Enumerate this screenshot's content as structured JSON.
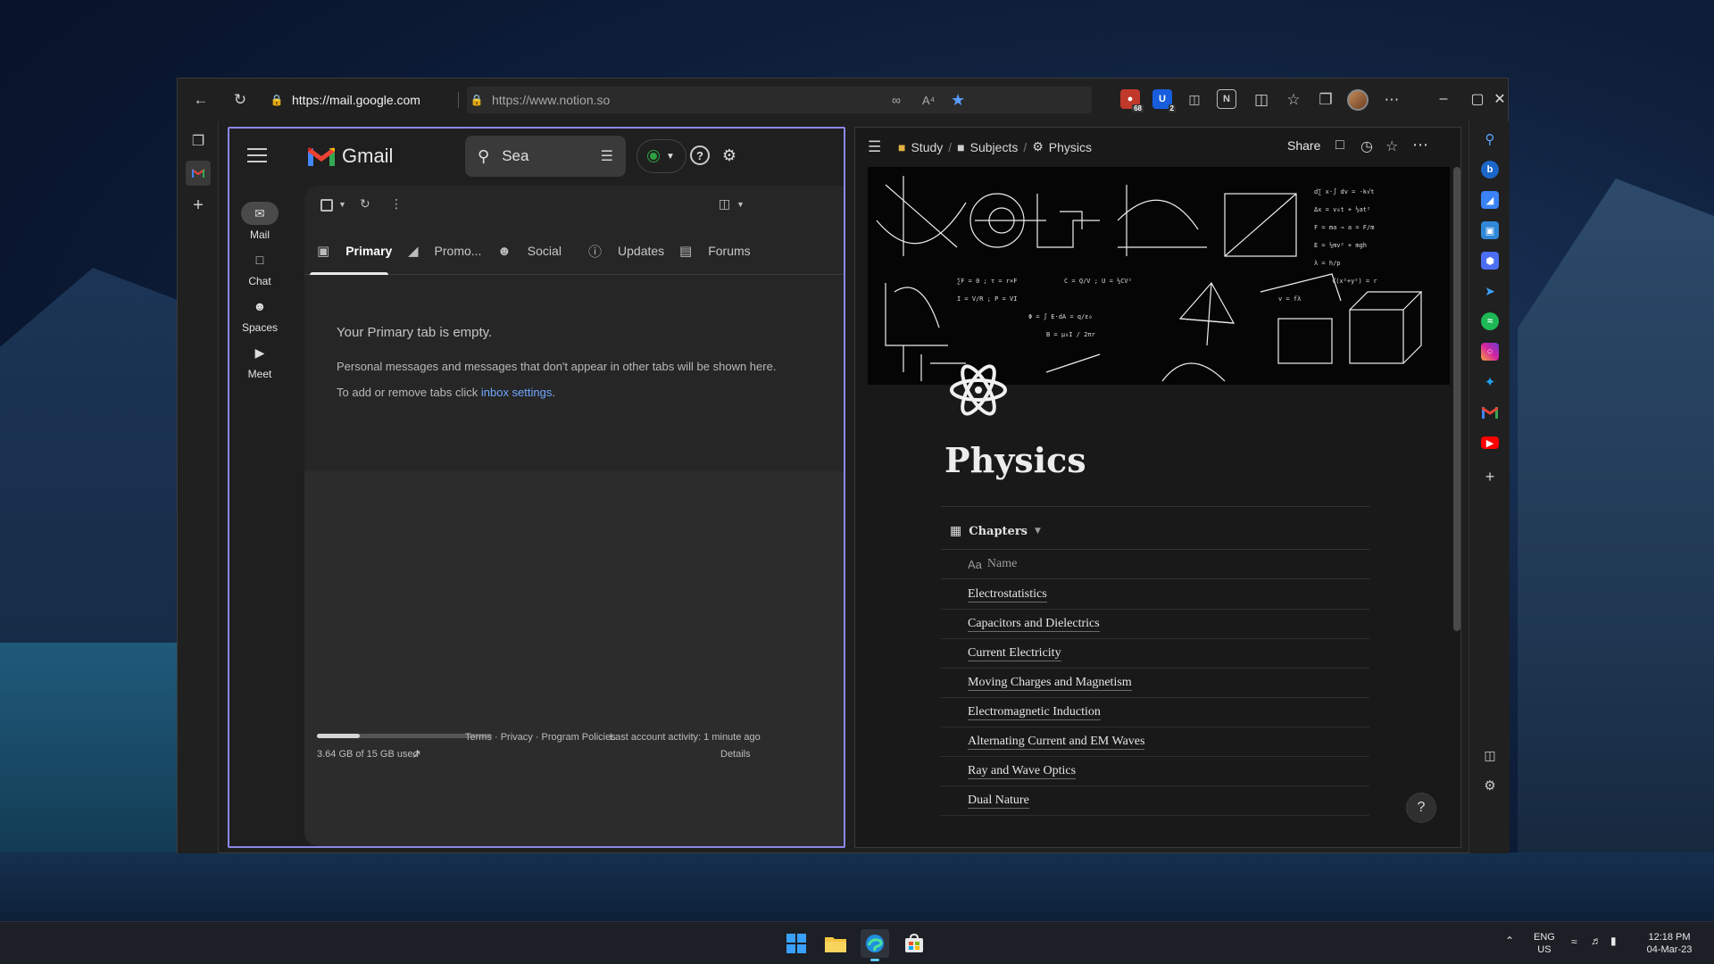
{
  "browser": {
    "url_primary": "https://mail.google.com",
    "url_secondary": "https://www.notion.so",
    "extensions": [
      {
        "name": "extension-1",
        "badge": "68",
        "color": "#c0392b"
      },
      {
        "name": "bitwarden",
        "badge": "2",
        "color": "#175ddc"
      },
      {
        "name": "clipboard",
        "badge": "",
        "color": "#555555"
      },
      {
        "name": "notion-clipper",
        "badge": "",
        "color": "#444444"
      }
    ],
    "menu_label": "⋯"
  },
  "gmail": {
    "app_name": "Gmail",
    "search_text": "Sea",
    "rail": [
      {
        "label": "Mail",
        "icon": "mail-icon"
      },
      {
        "label": "Chat",
        "icon": "chat-icon"
      },
      {
        "label": "Spaces",
        "icon": "spaces-icon"
      },
      {
        "label": "Meet",
        "icon": "meet-icon"
      }
    ],
    "tabs": [
      {
        "label": "Primary",
        "icon": "inbox-icon"
      },
      {
        "label": "Promo...",
        "icon": "tag-icon"
      },
      {
        "label": "Social",
        "icon": "people-icon"
      },
      {
        "label": "Updates",
        "icon": "info-icon"
      },
      {
        "label": "Forums",
        "icon": "forum-icon"
      }
    ],
    "empty_title": "Your Primary tab is empty.",
    "empty_desc": "Personal messages and messages that don't appear in other tabs will be shown here.",
    "empty_add": "To add or remove tabs click ",
    "empty_link": "inbox settings",
    "empty_end": ".",
    "storage_used": "3.64 GB of 15 GB used",
    "storage_fraction": 0.243,
    "footer_links": "Terms · Privacy · Program Policies",
    "last_activity": "Last account activity: 1 minute ago",
    "details": "Details"
  },
  "notion": {
    "breadcrumbs": [
      "Study",
      "Subjects",
      "Physics"
    ],
    "share_label": "Share",
    "title": "Physics",
    "database_title": "Chapters",
    "column_icon": "Aa",
    "column_name": "Name",
    "rows": [
      "Electrostatistics",
      "Capacitors and Dielectrics",
      "Current Electricity",
      "Moving Charges and Magnetism",
      "Electromagnetic Induction",
      "Alternating Current and EM Waves",
      "Ray and Wave Optics",
      "Dual Nature"
    ],
    "help_label": "?"
  },
  "taskbar": {
    "lang_top": "ENG",
    "lang_bottom": "US",
    "time": "12:18 PM",
    "date": "04-Mar-23"
  }
}
